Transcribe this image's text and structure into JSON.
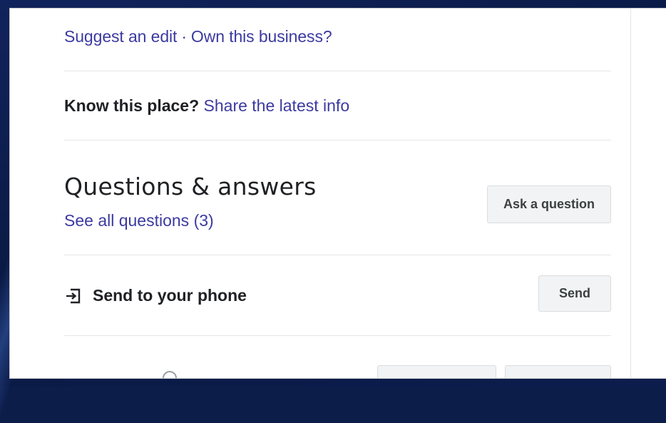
{
  "edit_row": {
    "suggest_edit": "Suggest an edit",
    "separator": "·",
    "own_business": "Own this business?"
  },
  "know_row": {
    "label": "Know this place?",
    "link": "Share the latest info"
  },
  "qa": {
    "title": "Questions & answers",
    "see_all": "See all questions (3)",
    "ask_button": "Ask a question"
  },
  "send_row": {
    "label": "Send to your phone",
    "button": "Send",
    "icon": "send-to-phone-icon"
  },
  "colors": {
    "link": "#3c3aa0",
    "text": "#202124",
    "button_bg": "#f1f3f4",
    "frame_bg": "#0d1d4a"
  }
}
